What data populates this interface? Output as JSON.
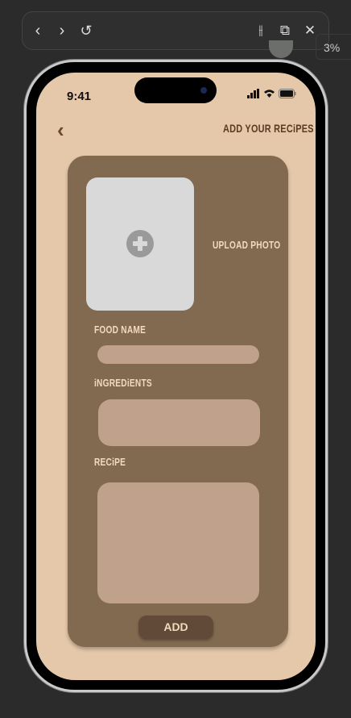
{
  "toolbar": {
    "back_icon": "chevron-left",
    "forward_icon": "chevron-right",
    "reload_icon": "undo-arrow",
    "settings_icon": "sliders",
    "open_external_icon": "external-link",
    "close_icon": "x"
  },
  "side_panel": {
    "percent": "3%"
  },
  "status_bar": {
    "time": "9:41"
  },
  "header": {
    "title": "ADD YOUR RECiPES",
    "back_icon": "chevron-left"
  },
  "form": {
    "upload_label": "UPLOAD PHOTO",
    "food_name_label": "FOOD NAME",
    "ingredients_label": "iNGREDiENTS",
    "recipe_label": "RECiPE",
    "add_label": "ADD"
  },
  "colors": {
    "screen_bg": "#e5c7a9",
    "card": "#826a51",
    "field": "#bfa18c",
    "button": "#614a37",
    "text_light": "#f3d9bd",
    "title": "#5a3a22"
  }
}
